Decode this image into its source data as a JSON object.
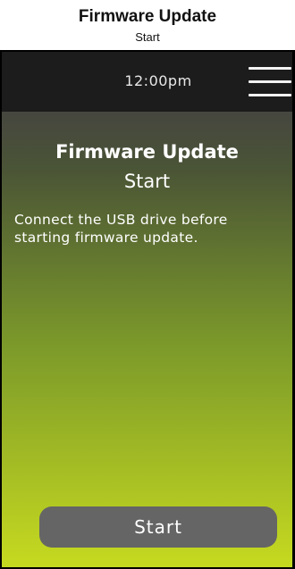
{
  "header": {
    "title": "Firmware Update",
    "subtitle": "Start"
  },
  "status_bar": {
    "time": "12:00pm",
    "menu_icon": "hamburger-menu-icon"
  },
  "content": {
    "title": "Firmware Update",
    "subtitle": "Start",
    "message": "Connect the USB drive before starting firmware update."
  },
  "actions": {
    "start_label": "Start"
  },
  "colors": {
    "status_bar": "#1c1c1c",
    "gradient_top": "#46473f",
    "gradient_bottom": "#c4d820",
    "button": "#656565"
  }
}
